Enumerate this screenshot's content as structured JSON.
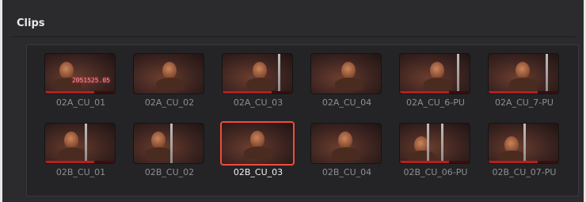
{
  "panel": {
    "title": "Clips"
  },
  "clips": [
    {
      "name": "02A_CU_01",
      "slate": "2051525.05",
      "selected": false
    },
    {
      "name": "02A_CU_02",
      "selected": false
    },
    {
      "name": "02A_CU_03",
      "selected": false
    },
    {
      "name": "02A_CU_04",
      "selected": false
    },
    {
      "name": "02A_CU_6-PU",
      "selected": false
    },
    {
      "name": "02A_CU_7-PU",
      "selected": false
    },
    {
      "name": "02B_CU_01",
      "selected": false
    },
    {
      "name": "02B_CU_02",
      "selected": false
    },
    {
      "name": "02B_CU_03",
      "selected": true
    },
    {
      "name": "02B_CU_04",
      "selected": false
    },
    {
      "name": "02B_CU_06-PU",
      "selected": false
    },
    {
      "name": "02B_CU_07-PU",
      "selected": false
    }
  ],
  "colors": {
    "selection": "#f04b3c",
    "background": "#2b2b2e"
  }
}
